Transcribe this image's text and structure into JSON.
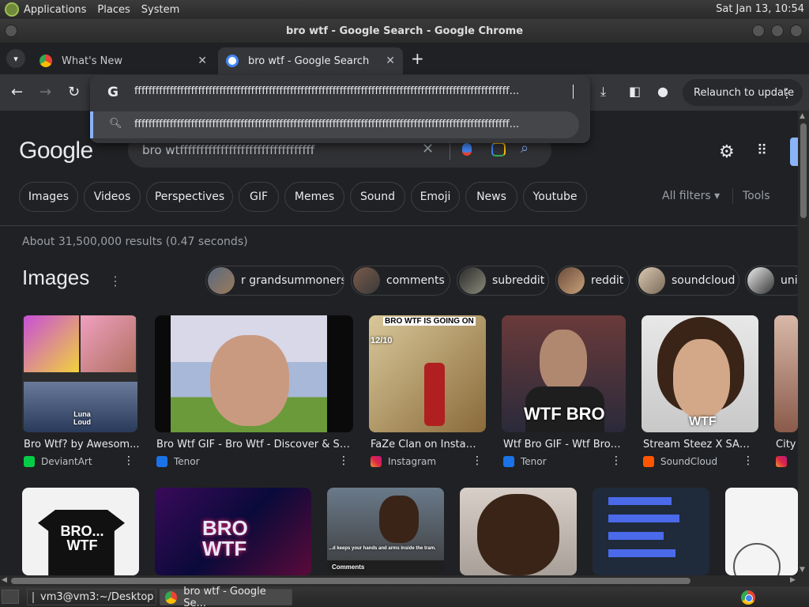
{
  "top_panel": {
    "menus": [
      "Applications",
      "Places",
      "System"
    ],
    "clock": "Sat Jan 13, 10:54"
  },
  "window": {
    "title": "bro wtf - Google Search - Google Chrome"
  },
  "tabs": [
    {
      "label": "What's New",
      "favicon": "chrome-icon"
    },
    {
      "label": "bro wtf - Google Search",
      "favicon": "google-icon",
      "active": true
    }
  ],
  "toolbar": {
    "relaunch_label": "Relaunch to update"
  },
  "omnibox": {
    "text": "ffffffffffffffffffffffffffffffffffffffffffffffffffffffffffffffffffffffffffffffffffffffffffffffffffffffffff...",
    "suggestion": "ffffffffffffffffffffffffffffffffffffffffffffffffffffffffffffffffffffffffffffffffffffffffffffffffffffffffff..."
  },
  "google": {
    "logo": "Google",
    "search_value": "bro wtfffffffffffffffffffffffffffffffff",
    "chips": [
      "Images",
      "Videos",
      "Perspectives",
      "GIF",
      "Memes",
      "Sound",
      "Emoji",
      "News",
      "Youtube"
    ],
    "all_filters": "All filters",
    "tools": "Tools",
    "results_count": "About 31,500,000 results (0.47 seconds)",
    "images_heading": "Images",
    "related": [
      "r grandsummoners",
      "comments",
      "subreddit",
      "reddit",
      "soundcloud",
      "uni"
    ],
    "results": [
      {
        "title": "Bro Wtf? by Awesom...",
        "source": "DeviantArt",
        "overlay": "Luna Loud"
      },
      {
        "title": "Bro Wtf GIF - Bro Wtf - Discover & Sh...",
        "source": "Tenor",
        "overlay": ""
      },
      {
        "title": "FaZe Clan on Instagr...",
        "source": "Instagram",
        "overlay": "BRO WTF IS GOING ON",
        "overlay2": "12/10"
      },
      {
        "title": "Wtf Bro GIF - Wtf Bro ...",
        "source": "Tenor",
        "overlay": "WTF BRO"
      },
      {
        "title": "Stream Steez X SAD...",
        "source": "SoundCloud",
        "overlay": "WTF"
      },
      {
        "title": "City",
        "source": ""
      }
    ],
    "row2_labels": {
      "shirt": "BRO... WTF",
      "neon": "BRO WTF",
      "caption": "...d keeps your hands and arms inside the tram.",
      "comments": "Comments"
    }
  },
  "taskbar": {
    "items": [
      "vm3@vm3:~/Desktop",
      "bro wtf - Google Se..."
    ]
  },
  "colors": {
    "accent": "#8ab4f8",
    "background": "#202124",
    "surface": "#35363a"
  }
}
